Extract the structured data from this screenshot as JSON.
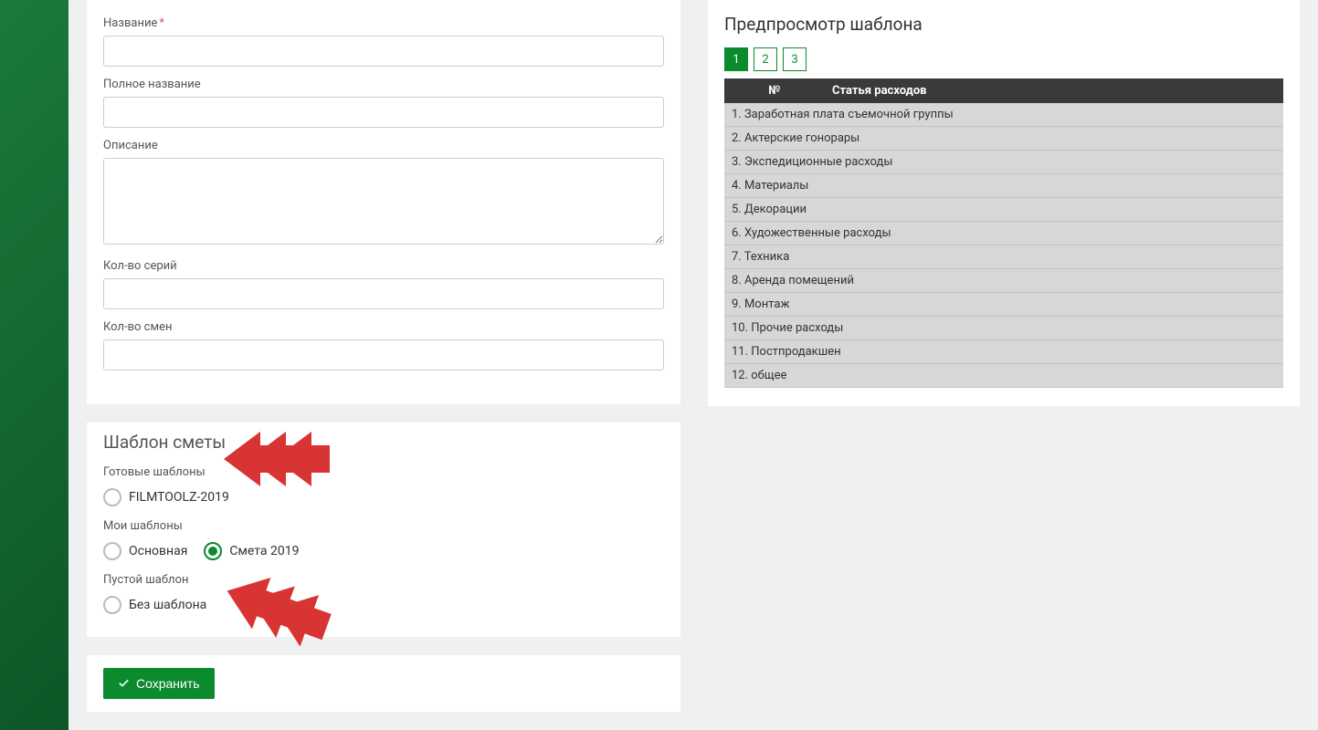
{
  "form": {
    "name_label": "Название",
    "full_name_label": "Полное название",
    "description_label": "Описание",
    "series_count_label": "Кол-во серий",
    "shifts_count_label": "Кол-во смен"
  },
  "template": {
    "title": "Шаблон сметы",
    "ready_label": "Готовые шаблоны",
    "ready_options": [
      {
        "label": "FILMTOOLZ-2019",
        "checked": false
      }
    ],
    "my_label": "Мои шаблоны",
    "my_options": [
      {
        "label": "Основная",
        "checked": false
      },
      {
        "label": "Смета 2019",
        "checked": true
      }
    ],
    "empty_label": "Пустой шаблон",
    "empty_options": [
      {
        "label": "Без шаблона",
        "checked": false
      }
    ]
  },
  "actions": {
    "save_label": "Сохранить"
  },
  "preview": {
    "title": "Предпросмотр шаблона",
    "tabs": [
      "1",
      "2",
      "3"
    ],
    "active_tab": 0,
    "table": {
      "col_num": "№",
      "col_item": "Статья расходов",
      "rows": [
        {
          "n": "1.",
          "label": "Заработная плата съемочной группы"
        },
        {
          "n": "2.",
          "label": "Актерские гонорары"
        },
        {
          "n": "3.",
          "label": "Экспедиционные расходы"
        },
        {
          "n": "4.",
          "label": "Материалы"
        },
        {
          "n": "5.",
          "label": "Декорации"
        },
        {
          "n": "6.",
          "label": "Художественные расходы"
        },
        {
          "n": "7.",
          "label": "Техника"
        },
        {
          "n": "8.",
          "label": "Аренда помещений"
        },
        {
          "n": "9.",
          "label": "Монтаж"
        },
        {
          "n": "10.",
          "label": "Прочие расходы"
        },
        {
          "n": "11.",
          "label": "Постпродакшен"
        },
        {
          "n": "12.",
          "label": "общее"
        }
      ]
    }
  }
}
